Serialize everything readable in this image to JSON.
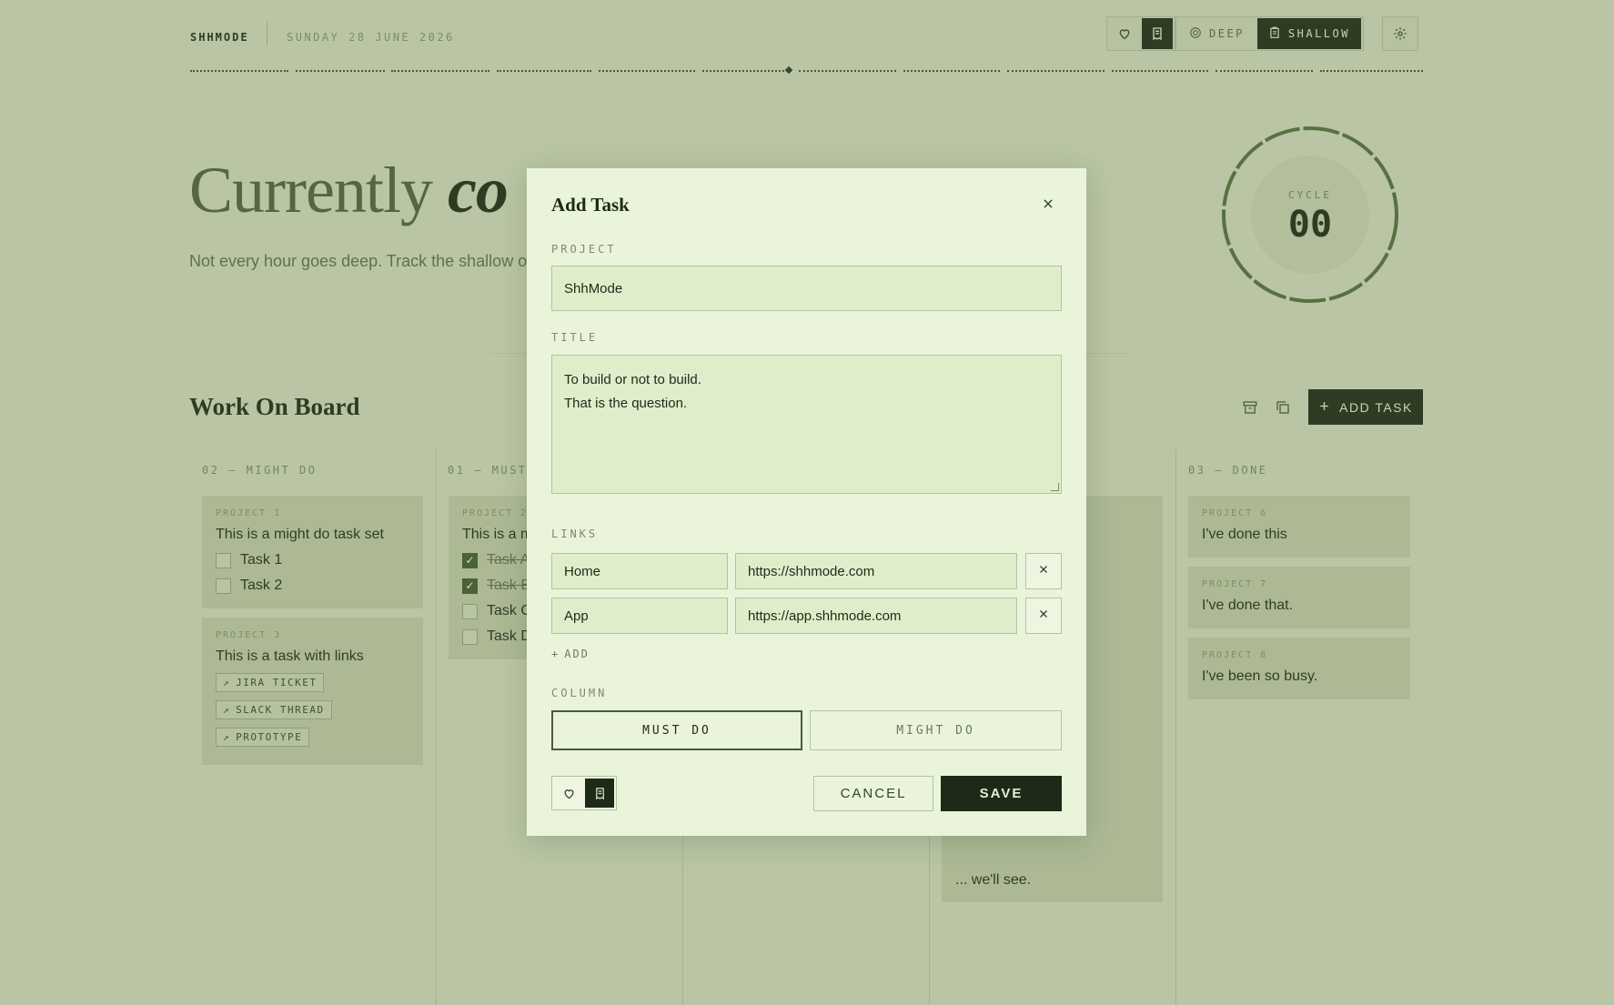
{
  "header": {
    "brand": "SHHMODE",
    "date": "SUNDAY 28 JUNE 2026",
    "mode_deep": "DEEP",
    "mode_shallow": "SHALLOW"
  },
  "hero": {
    "title_plain": "Currently ",
    "title_em": "co",
    "subtitle": "Not every hour goes deep. Track the shallow one"
  },
  "cycle": {
    "label": "CYCLE",
    "value": "00"
  },
  "board": {
    "title": "Work On Board",
    "add_task": "ADD TASK",
    "columns": [
      {
        "label": "02 — MIGHT DO"
      },
      {
        "label": "01 — MUST"
      },
      {
        "label": "03 — DONE"
      }
    ],
    "might": {
      "card1": {
        "project": "PROJECT 1",
        "title": "This is a might do task set",
        "items": [
          "Task 1",
          "Task 2"
        ]
      },
      "card2": {
        "project": "PROJECT 3",
        "title": "This is a task with links",
        "links": [
          "JIRA TICKET",
          "SLACK THREAD",
          "PROTOTYPE"
        ]
      }
    },
    "must": {
      "card1": {
        "project": "PROJECT 2",
        "title": "This is a m",
        "items": [
          "Task A",
          "Task B",
          "Task C",
          "Task D"
        ]
      }
    },
    "doing_tail": "... we'll see.",
    "done": [
      {
        "project": "PROJECT 6",
        "title": "I've done this"
      },
      {
        "project": "PROJECT 7",
        "title": "I've done that."
      },
      {
        "project": "PROJECT 8",
        "title": "I've been so busy."
      }
    ]
  },
  "modal": {
    "title": "Add Task",
    "project_label": "PROJECT",
    "project_value": "ShhMode",
    "title_label": "TITLE",
    "title_line1": "To build or not to build.",
    "title_line2": "That is the question.",
    "links_label": "LINKS",
    "links": [
      {
        "name": "Home",
        "url": "https://shhmode.com"
      },
      {
        "name": "App",
        "url": "https://app.shhmode.com"
      }
    ],
    "add_label": "ADD",
    "column_label": "COLUMN",
    "column_options": [
      "MUST DO",
      "MIGHT DO"
    ],
    "cancel": "CANCEL",
    "save": "SAVE"
  },
  "icons": {
    "heart": "heart-icon",
    "receipt": "receipt-icon",
    "target": "target-icon",
    "clipboard": "clipboard-icon",
    "gear": "gear-icon",
    "archive": "archive-icon",
    "copy": "copy-icon",
    "plus": "plus-icon",
    "close": "close-icon",
    "external": "external-link-icon"
  },
  "colors": {
    "background": "#c6d1b4",
    "modal": "#eaf4da",
    "dark": "#1e2a18",
    "accent": "#3d5a2e"
  }
}
